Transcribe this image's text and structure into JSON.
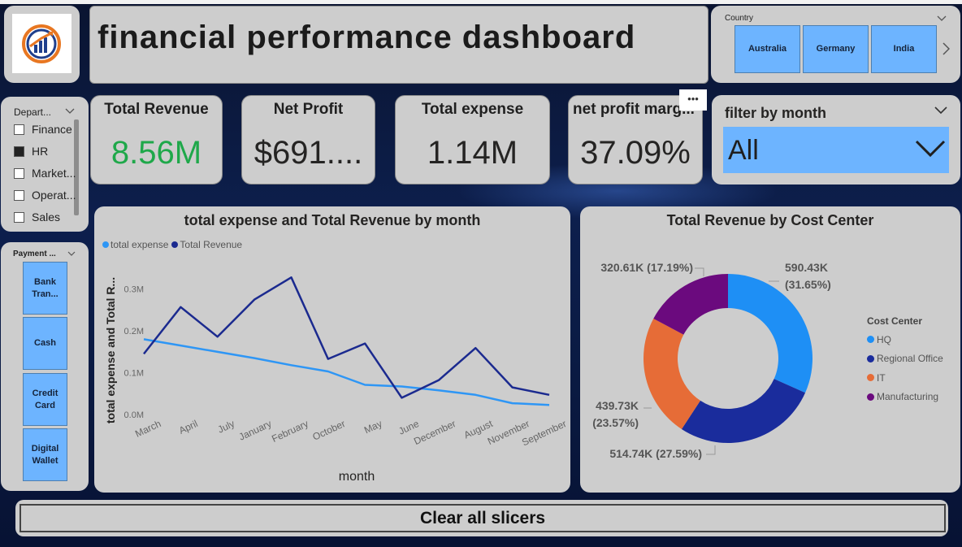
{
  "header": {
    "title": "financial performance dashboard"
  },
  "country_slicer": {
    "title": "Country",
    "options": [
      "Australia",
      "Germany",
      "India"
    ]
  },
  "kpis": [
    {
      "label": "Total Revenue",
      "value": "8.56M",
      "color": "#1fa84a"
    },
    {
      "label": "Net Profit",
      "value": "$691....",
      "color": "#252423"
    },
    {
      "label": "Total expense",
      "value": "1.14M",
      "color": "#252423"
    },
    {
      "label": "net profit marg...",
      "value": "37.09%",
      "color": "#252423"
    }
  ],
  "more_options": "•••",
  "month_filter": {
    "title": "filter by month",
    "value": "All"
  },
  "department_slicer": {
    "title": "Depart...",
    "items": [
      {
        "label": "Finance",
        "checked": false
      },
      {
        "label": "HR",
        "checked": true
      },
      {
        "label": "Market...",
        "checked": false
      },
      {
        "label": "Operat...",
        "checked": false
      },
      {
        "label": "Sales",
        "checked": false
      }
    ]
  },
  "payment_slicer": {
    "title": "Payment ...",
    "options": [
      "Bank Tran...",
      "Cash",
      "Credit Card",
      "Digital Wallet"
    ]
  },
  "line_chart": {
    "title": "total expense and Total Revenue by month",
    "legend": [
      "total expense",
      "Total Revenue"
    ],
    "xlabel": "month",
    "ylabel": "total expense and Total R...",
    "ytick_labels": [
      "0.0M",
      "0.1M",
      "0.2M",
      "0.3M"
    ]
  },
  "donut_chart": {
    "title": "Total Revenue by Cost Center",
    "legend_title": "Cost Center",
    "labels": [
      "590.43K (31.65%)",
      "514.74K (27.59%)",
      "439.73K (23.57%)",
      "320.61K (17.19%)"
    ]
  },
  "clear_button": {
    "label": "Clear all slicers"
  },
  "colors": {
    "accent": "#6db4ff",
    "expense_line": "#2e96f5",
    "revenue_line": "#1b2a8f"
  },
  "chart_data": [
    {
      "type": "line",
      "title": "total expense and Total Revenue by month",
      "x": [
        "March",
        "April",
        "July",
        "January",
        "February",
        "October",
        "May",
        "June",
        "December",
        "August",
        "November",
        "September"
      ],
      "series": [
        {
          "name": "total expense",
          "color": "#2e96f5",
          "values": [
            0.18,
            0.165,
            0.15,
            0.135,
            0.118,
            0.103,
            0.071,
            0.067,
            0.058,
            0.047,
            0.027,
            0.023
          ]
        },
        {
          "name": "Total Revenue",
          "color": "#1b2a8f",
          "values": [
            0.145,
            0.257,
            0.186,
            0.275,
            0.328,
            0.133,
            0.17,
            0.04,
            0.082,
            0.159,
            0.065,
            0.047
          ]
        }
      ],
      "xlabel": "month",
      "ylabel": "total expense and Total R...",
      "ylim": [
        0,
        0.35
      ],
      "yticks": [
        0,
        0.1,
        0.2,
        0.3
      ],
      "grid": false,
      "legend": "top-left"
    },
    {
      "type": "pie",
      "title": "Total Revenue by Cost Center",
      "categories": [
        "HQ",
        "Regional Office",
        "IT",
        "Manufacturing"
      ],
      "values": [
        590.43,
        514.74,
        439.73,
        320.61
      ],
      "percent": [
        31.65,
        27.59,
        23.57,
        17.19
      ],
      "colors": [
        "#1e8ff5",
        "#1a2c9c",
        "#e66c37",
        "#6b0a7e"
      ],
      "donut": true,
      "legend": "right"
    }
  ]
}
